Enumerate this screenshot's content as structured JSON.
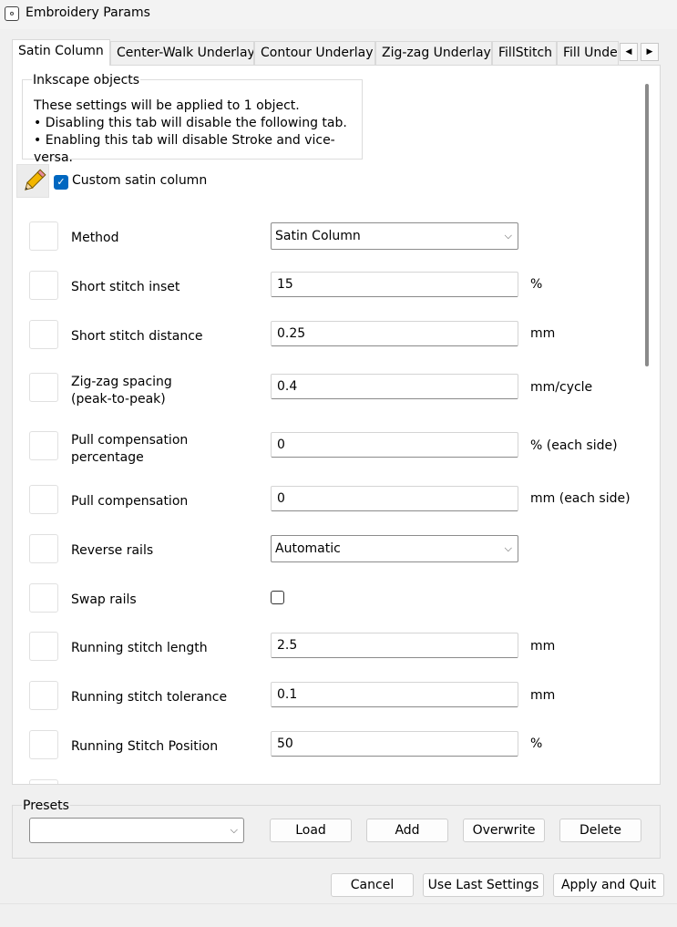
{
  "window": {
    "title": "Embroidery Params",
    "icon": "inkstitch-app-icon"
  },
  "tabs": [
    {
      "label": "Satin Column",
      "active": true
    },
    {
      "label": "Center-Walk Underlay"
    },
    {
      "label": "Contour Underlay"
    },
    {
      "label": "Zig-zag Underlay"
    },
    {
      "label": "FillStitch"
    },
    {
      "label": "Fill Unde"
    }
  ],
  "tab_scroll": {
    "left": "◀",
    "right": "▶"
  },
  "group": {
    "title": "Inkscape objects",
    "line1": "These settings will be applied to 1 object.",
    "line2": "• Disabling this tab will disable the following tab.",
    "line3": "• Enabling this tab will disable Stroke and vice-versa."
  },
  "custom_satin": {
    "label": "Custom satin column",
    "checked": true,
    "check_mark": "✓"
  },
  "params": [
    {
      "name": "method",
      "label": "Method",
      "kind": "select",
      "value": "Satin Column",
      "unit": ""
    },
    {
      "name": "short-stitch-inset",
      "label": "Short stitch inset",
      "kind": "text",
      "value": "15",
      "unit": "%"
    },
    {
      "name": "short-stitch-distance",
      "label": "Short stitch distance",
      "kind": "text",
      "value": "0.25",
      "unit": "mm"
    },
    {
      "name": "zigzag-spacing",
      "label_lines": [
        "Zig-zag spacing",
        "(peak-to-peak)"
      ],
      "kind": "text",
      "value": "0.4",
      "unit": "mm/cycle"
    },
    {
      "name": "pull-comp-percentage",
      "label_lines": [
        "Pull compensation",
        "percentage"
      ],
      "kind": "text",
      "value": "0",
      "unit": "% (each side)"
    },
    {
      "name": "pull-compensation",
      "label": "Pull compensation",
      "kind": "text",
      "value": "0",
      "unit": "mm (each side)"
    },
    {
      "name": "reverse-rails",
      "label": "Reverse rails",
      "kind": "select",
      "value": "Automatic",
      "unit": ""
    },
    {
      "name": "swap-rails",
      "label": "Swap rails",
      "kind": "checkbox",
      "checked": false,
      "unit": ""
    },
    {
      "name": "running-stitch-length",
      "label": "Running stitch length",
      "kind": "text",
      "value": "2.5",
      "unit": "mm"
    },
    {
      "name": "running-stitch-tolerance",
      "label": "Running stitch tolerance",
      "kind": "text",
      "value": "0.1",
      "unit": "mm"
    },
    {
      "name": "running-stitch-position",
      "label": "Running Stitch Position",
      "kind": "text",
      "value": "50",
      "unit": "%"
    }
  ],
  "dropdown_chevron": "⌵",
  "presets": {
    "title": "Presets",
    "combo_value": "",
    "load": "Load",
    "add": "Add",
    "overwrite": "Overwrite",
    "delete": "Delete"
  },
  "footer": {
    "cancel": "Cancel",
    "use_last": "Use Last Settings",
    "apply_quit": "Apply and Quit"
  }
}
